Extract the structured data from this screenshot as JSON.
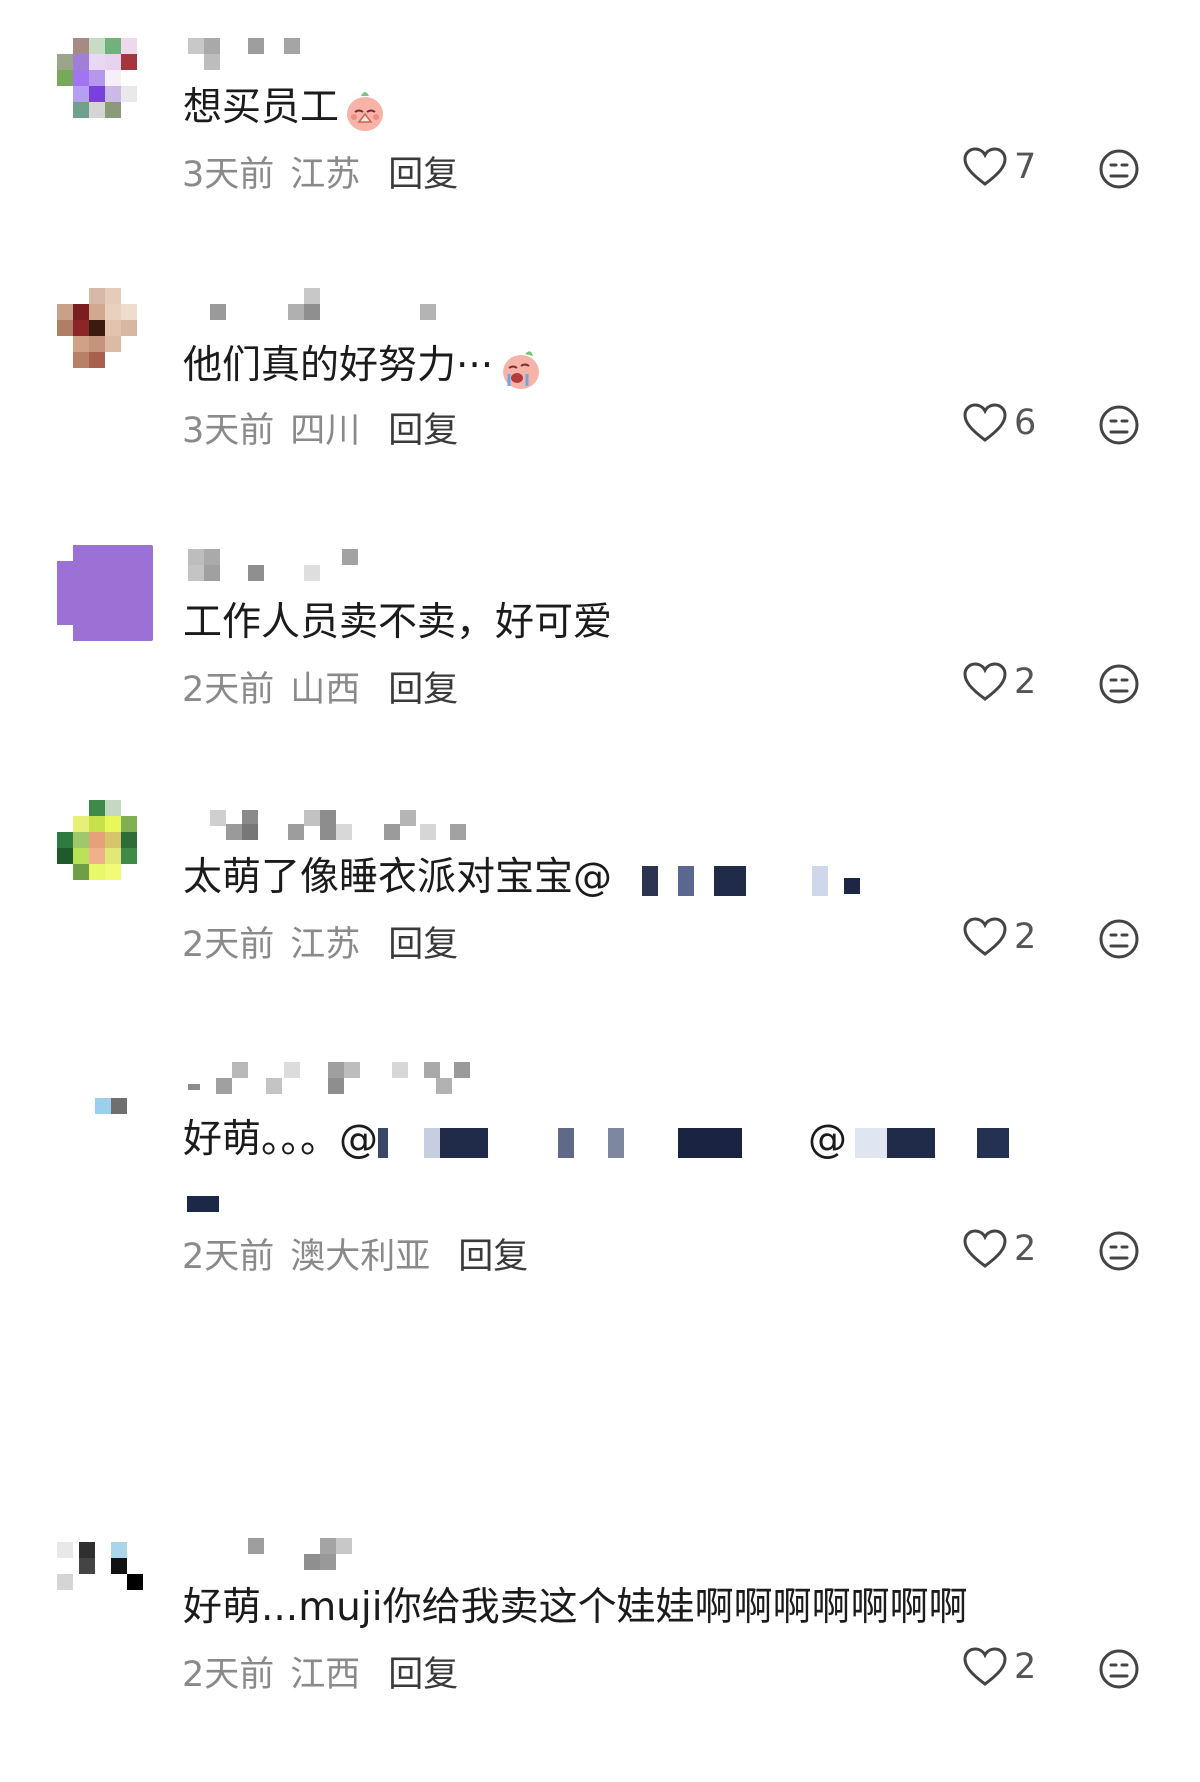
{
  "comments": [
    {
      "text": "想买员工",
      "time": "3天前",
      "region": "江苏",
      "reply": "回复",
      "likes": "7",
      "emoji": "pray-emoji"
    },
    {
      "text": "他们真的好努力···",
      "time": "3天前",
      "region": "四川",
      "reply": "回复",
      "likes": "6",
      "emoji": "crying-emoji"
    },
    {
      "text": "工作人员卖不卖，好可爱",
      "time": "2天前",
      "region": "山西",
      "reply": "回复",
      "likes": "2"
    },
    {
      "text": "太萌了像睡衣派对宝宝@",
      "time": "2天前",
      "region": "江苏",
      "reply": "回复",
      "likes": "2"
    },
    {
      "text": "好萌。。。@",
      "text_b": "@",
      "time": "2天前",
      "region": "澳大利亚",
      "reply": "回复",
      "likes": "2"
    },
    {
      "text": "好萌...muji你给我卖这个娃娃啊啊啊啊啊啊啊",
      "time": "2天前",
      "region": "江西",
      "reply": "回复",
      "likes": "2"
    }
  ],
  "colors": {
    "text": "#1b1b1b",
    "meta": "#8a8a8a",
    "reply": "#3a3a3a",
    "icon": "#444444"
  }
}
